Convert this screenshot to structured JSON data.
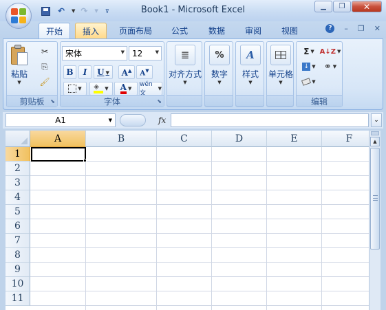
{
  "window": {
    "title": "Book1 - Microsoft Excel"
  },
  "window_controls": {
    "minimize": "▁",
    "restore": "❐",
    "close": "✕"
  },
  "tabs": [
    {
      "label": "开始",
      "state": "active"
    },
    {
      "label": "插入",
      "state": "hover"
    },
    {
      "label": "页面布局",
      "state": "normal"
    },
    {
      "label": "公式",
      "state": "normal"
    },
    {
      "label": "数据",
      "state": "normal"
    },
    {
      "label": "审阅",
      "state": "normal"
    },
    {
      "label": "视图",
      "state": "normal"
    }
  ],
  "ribbon": {
    "clipboard": {
      "label": "剪贴板",
      "paste_label": "粘贴"
    },
    "font": {
      "label": "字体",
      "font_name": "宋体",
      "font_size": "12",
      "bold": "B",
      "italic": "I",
      "underline": "U",
      "phonetic": "wén文"
    },
    "alignment": {
      "label": "对齐方式"
    },
    "number": {
      "label": "数字",
      "icon_text": "%"
    },
    "styles": {
      "label": "样式"
    },
    "cells": {
      "label": "单元格"
    },
    "editing": {
      "label": "编辑"
    }
  },
  "formula_bar": {
    "name_box": "A1",
    "fx_label": "fx",
    "content": ""
  },
  "sheet": {
    "columns": [
      "A",
      "B",
      "C",
      "D",
      "E",
      "F"
    ],
    "rows": [
      "1",
      "2",
      "3",
      "4",
      "5",
      "6",
      "7",
      "8",
      "9",
      "10",
      "11"
    ],
    "active_cell": "A1"
  },
  "colors": {
    "accent": "#15428b",
    "selected_header": "#f1c15f",
    "ribbon_bg": "#dbe7f6"
  }
}
